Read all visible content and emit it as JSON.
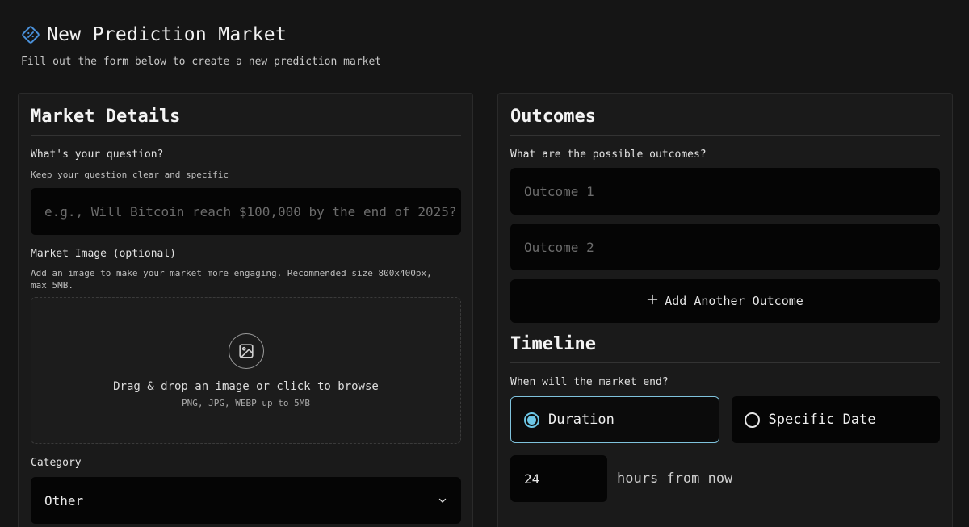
{
  "header": {
    "logo_icon": "prediction-logo-icon",
    "title": "New Prediction Market",
    "subtitle": "Fill out the form below to create a new prediction market"
  },
  "market_details": {
    "section_title": "Market Details",
    "question": {
      "label": "What's your question?",
      "hint": "Keep your question clear and specific",
      "value": "",
      "placeholder": "e.g., Will Bitcoin reach $100,000 by the end of 2025?"
    },
    "image": {
      "label": "Market Image (optional)",
      "hint": "Add an image to make your market more engaging. Recommended size 800x400px, max 5MB.",
      "drop_text": "Drag & drop an image or click to browse",
      "drop_sub": "PNG, JPG, WEBP up to 5MB",
      "icon": "image-icon"
    },
    "category": {
      "label": "Category",
      "selected": "Other",
      "icon": "chevron-down-icon"
    }
  },
  "outcomes": {
    "section_title": "Outcomes",
    "label": "What are the possible outcomes?",
    "items": [
      {
        "placeholder": "Outcome 1",
        "value": ""
      },
      {
        "placeholder": "Outcome 2",
        "value": ""
      }
    ],
    "add_label": "Add Another Outcome",
    "add_icon": "plus-icon"
  },
  "timeline": {
    "section_title": "Timeline",
    "label": "When will the market end?",
    "options": [
      {
        "label": "Duration",
        "selected": true
      },
      {
        "label": "Specific Date",
        "selected": false
      }
    ],
    "duration_value": "24",
    "duration_suffix": "hours from now"
  },
  "colors": {
    "accent": "#6ec7e6",
    "background": "#151515",
    "panel": "#1a1a1a",
    "input": "#050505"
  }
}
